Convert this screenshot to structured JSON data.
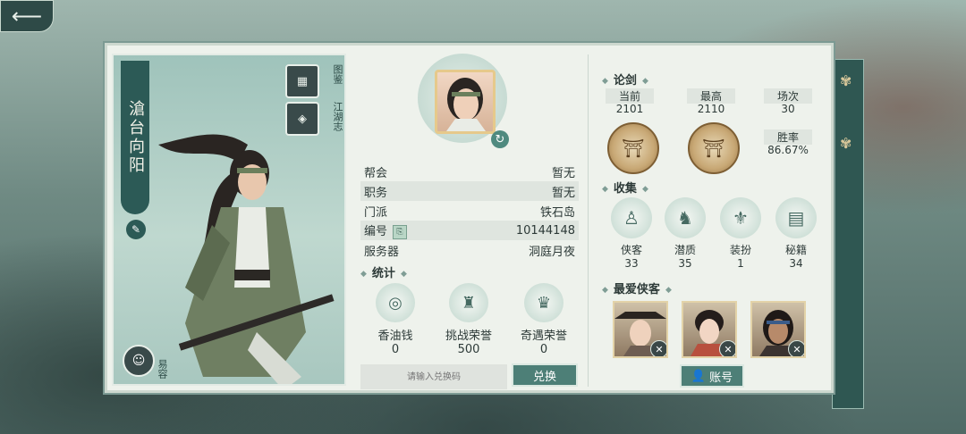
{
  "window": {
    "back_icon": "arrow-left-icon"
  },
  "character": {
    "name": "滄台向阳",
    "side_buttons": [
      {
        "label": "图鉴",
        "icon": "cards-icon"
      },
      {
        "label": "江湖志",
        "icon": "book-icon"
      }
    ],
    "face_label": "易容"
  },
  "profile": {
    "rows": [
      {
        "label": "帮会",
        "value": "暂无"
      },
      {
        "label": "职务",
        "value": "暂无"
      },
      {
        "label": "门派",
        "value": "铁石岛"
      },
      {
        "label": "编号",
        "value": "10144148"
      },
      {
        "label": "服务器",
        "value": "洞庭月夜"
      }
    ]
  },
  "stats": {
    "title": "统计",
    "items": [
      {
        "label": "香油钱",
        "value": "0",
        "icon": "coin-icon"
      },
      {
        "label": "挑战荣誉",
        "value": "500",
        "icon": "trophy-icon"
      },
      {
        "label": "奇遇荣誉",
        "value": "0",
        "icon": "medal-icon"
      }
    ]
  },
  "redeem": {
    "placeholder": "请输入兑换码",
    "button": "兑换"
  },
  "duel": {
    "title": "论剑",
    "current_label": "当前",
    "current_value": "2101",
    "best_label": "最高",
    "best_value": "2110",
    "matches_label": "场次",
    "matches_value": "30",
    "winrate_label": "胜率",
    "winrate_value": "86.67%"
  },
  "collection": {
    "title": "收集",
    "items": [
      {
        "label": "侠客",
        "value": "33",
        "icon": "hero-icon"
      },
      {
        "label": "潜质",
        "value": "35",
        "icon": "dragon-icon"
      },
      {
        "label": "装扮",
        "value": "1",
        "icon": "robe-icon"
      },
      {
        "label": "秘籍",
        "value": "34",
        "icon": "scroll-icon"
      }
    ]
  },
  "favorites": {
    "title": "最爱侠客",
    "account_button": "账号"
  }
}
